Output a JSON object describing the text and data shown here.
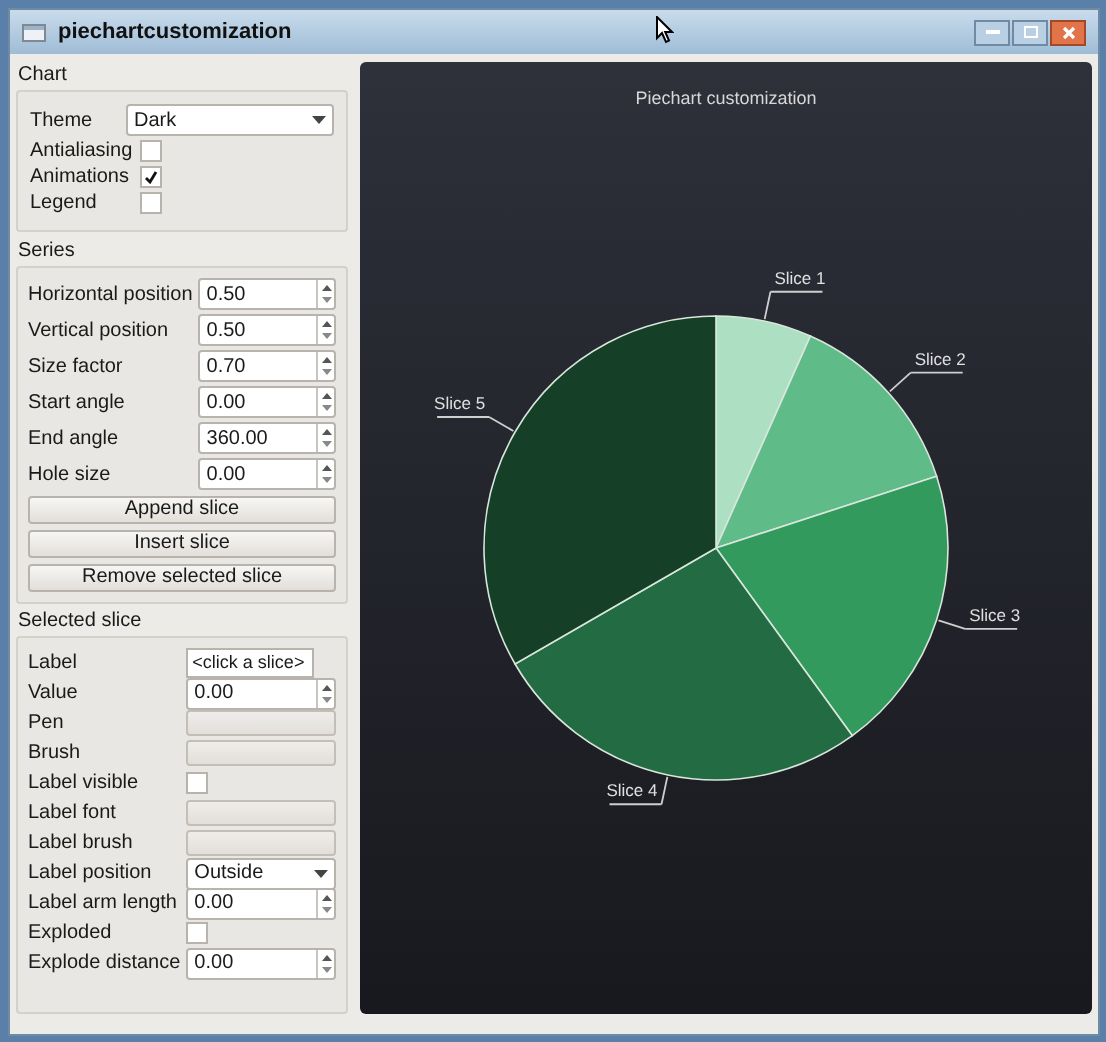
{
  "window": {
    "title": "piechartcustomization"
  },
  "chart_group": {
    "title": "Chart",
    "theme": {
      "label": "Theme",
      "value": "Dark"
    },
    "checkboxes": [
      {
        "label": "Antialiasing",
        "checked": false
      },
      {
        "label": "Animations",
        "checked": true
      },
      {
        "label": "Legend",
        "checked": false
      }
    ]
  },
  "series_group": {
    "title": "Series",
    "fields": [
      {
        "label": "Horizontal position",
        "value": "0.50"
      },
      {
        "label": "Vertical position",
        "value": "0.50"
      },
      {
        "label": "Size factor",
        "value": "0.70"
      },
      {
        "label": "Start angle",
        "value": "0.00"
      },
      {
        "label": "End angle",
        "value": "360.00"
      },
      {
        "label": "Hole size",
        "value": "0.00"
      }
    ],
    "buttons": [
      "Append slice",
      "Insert slice",
      "Remove selected slice"
    ]
  },
  "selected_slice": {
    "title": "Selected slice",
    "rows": [
      {
        "kind": "text",
        "label": "Label",
        "value": "<click a slice>"
      },
      {
        "kind": "spin",
        "label": "Value",
        "value": "0.00"
      },
      {
        "kind": "button",
        "label": "Pen"
      },
      {
        "kind": "button",
        "label": "Brush"
      },
      {
        "kind": "check",
        "label": "Label visible",
        "checked": false
      },
      {
        "kind": "button",
        "label": "Label font"
      },
      {
        "kind": "button",
        "label": "Label brush"
      },
      {
        "kind": "combo",
        "label": "Label position",
        "value": "Outside"
      },
      {
        "kind": "spin",
        "label": "Label arm length",
        "value": "0.00"
      },
      {
        "kind": "check",
        "label": "Exploded",
        "checked": false
      },
      {
        "kind": "spin",
        "label": "Explode distance",
        "value": "0.00"
      }
    ]
  },
  "chart": {
    "chart_data": {
      "type": "pie",
      "title": "Piechart customization",
      "categories": [
        "Slice 1",
        "Slice 2",
        "Slice 3",
        "Slice 4",
        "Slice 5"
      ],
      "values": [
        1,
        2,
        3,
        4,
        5
      ]
    }
  }
}
